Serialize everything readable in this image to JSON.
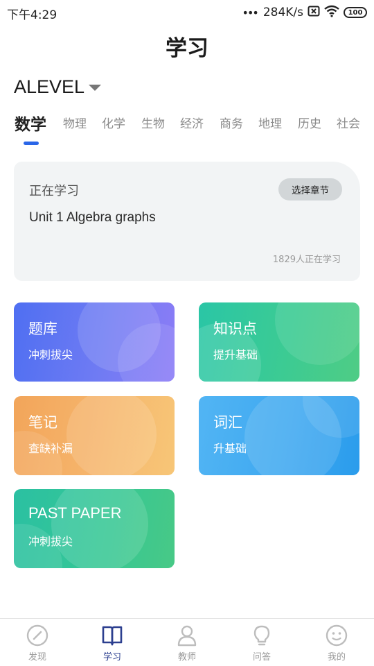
{
  "status_bar": {
    "time": "下午4:29",
    "dots": "•••",
    "speed": "284K/s",
    "battery": "100"
  },
  "header": {
    "title": "学习"
  },
  "exam": {
    "name": "ALEVEL"
  },
  "subjects": [
    {
      "label": "数学",
      "active": true
    },
    {
      "label": "物理",
      "active": false
    },
    {
      "label": "化学",
      "active": false
    },
    {
      "label": "生物",
      "active": false
    },
    {
      "label": "经济",
      "active": false
    },
    {
      "label": "商务",
      "active": false
    },
    {
      "label": "地理",
      "active": false
    },
    {
      "label": "历史",
      "active": false
    },
    {
      "label": "社会",
      "active": false
    }
  ],
  "learning": {
    "label": "正在学习",
    "unit": "Unit 1 Algebra graphs",
    "chapter_button": "选择章节",
    "learners": "1829人正在学习"
  },
  "features": [
    {
      "title": "题库",
      "subtitle": "冲刺拔尖"
    },
    {
      "title": "知识点",
      "subtitle": "提升基础"
    },
    {
      "title": "笔记",
      "subtitle": "查缺补漏"
    },
    {
      "title": "词汇",
      "subtitle": "升基础"
    },
    {
      "title": "PAST PAPER",
      "subtitle": "冲刺拔尖"
    }
  ],
  "nav": [
    {
      "label": "发现",
      "icon": "compass-icon",
      "active": false
    },
    {
      "label": "学习",
      "icon": "book-icon",
      "active": true
    },
    {
      "label": "教师",
      "icon": "teacher-icon",
      "active": false
    },
    {
      "label": "问答",
      "icon": "lightbulb-icon",
      "active": false
    },
    {
      "label": "我的",
      "icon": "smiley-icon",
      "active": false
    }
  ],
  "colors": {
    "accent": "#2a66e8",
    "nav_active": "#2c3f8f",
    "nav_inactive": "#bdbdbd"
  }
}
